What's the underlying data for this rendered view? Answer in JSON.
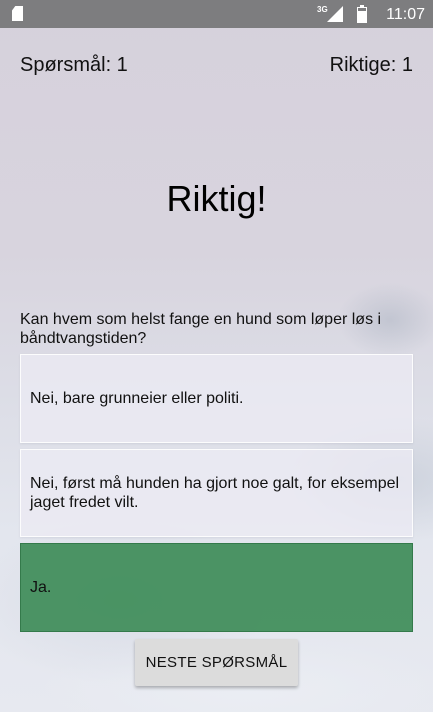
{
  "status_bar": {
    "network_type": "3G",
    "time": "11:07",
    "icons": [
      "sd-card-icon",
      "signal-icon",
      "battery-icon"
    ]
  },
  "header": {
    "question_counter": "Spørsmål: 1",
    "correct_counter": "Riktige: 1"
  },
  "result": {
    "text": "Riktig!"
  },
  "question": {
    "text": "Kan hvem som helst fange en hund som løper løs i båndtvangstiden?"
  },
  "answers": [
    {
      "label": "Nei, bare grunneier eller politi.",
      "state": "neutral"
    },
    {
      "label": "Nei, først må hunden ha gjort noe galt, for eksempel jaget fredet vilt.",
      "state": "neutral"
    },
    {
      "label": "Ja.",
      "state": "correct"
    }
  ],
  "next_button": {
    "label": "NESTE SPØRSMÅL"
  },
  "colors": {
    "status_bar": "#7d7d7f",
    "correct_answer": "#3e8c58",
    "neutral_answer": "#eceaf4",
    "button": "#dcdcdc"
  }
}
